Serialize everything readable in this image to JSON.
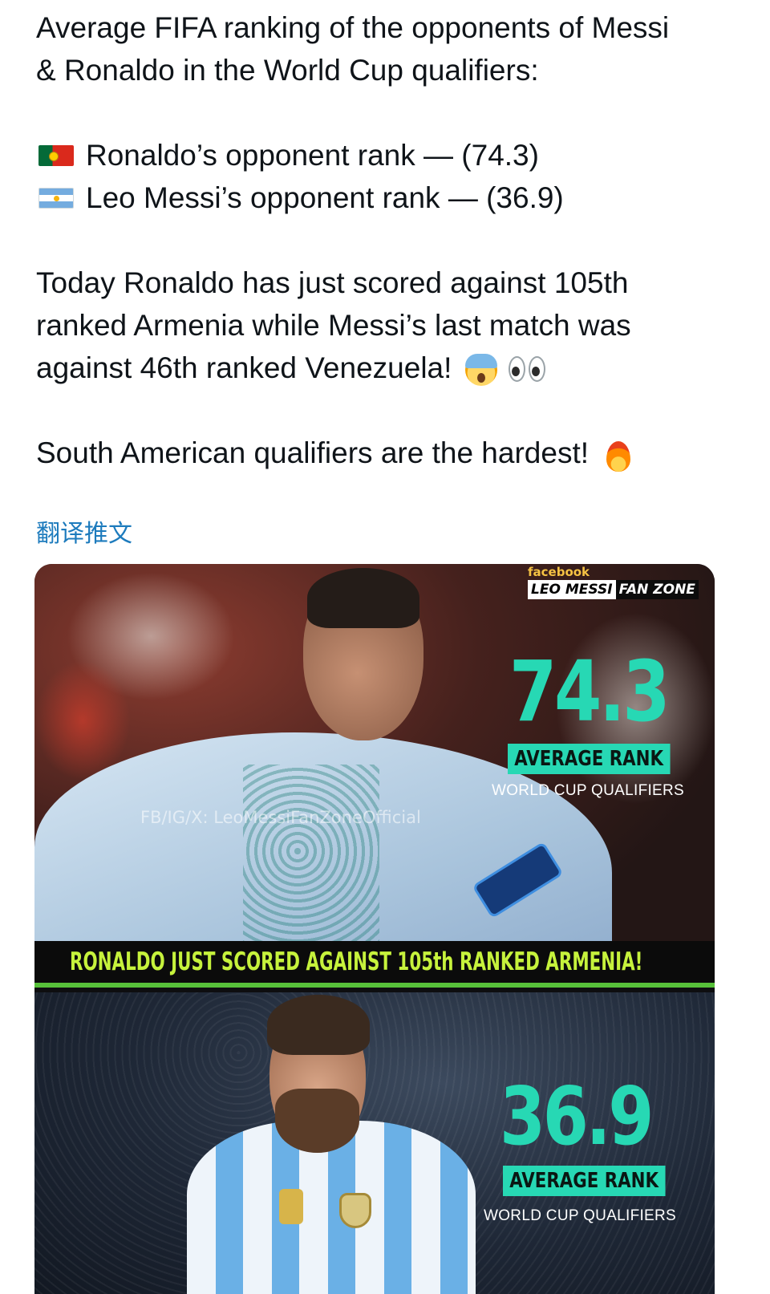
{
  "tweet": {
    "line1": "Average FIFA ranking of the opponents of Messi",
    "line2": "& Ronaldo in the World Cup qualifiers:",
    "ronaldo_line": "Ronaldo’s opponent rank — (74.3)",
    "messi_line": "Leo Messi’s opponent rank — (36.9)",
    "para2_line1": "Today Ronaldo has just scored against 105th",
    "para2_line2": "ranked Armenia while Messi’s last match was",
    "para2_line3": "against 46th ranked Venezuela!",
    "para3": "South American qualifiers are the hardest!",
    "translate_link": "翻译推文"
  },
  "icons": {
    "portugal_flag": "portugal-flag-icon",
    "argentina_flag": "argentina-flag-icon",
    "scream": "face-screaming-icon",
    "eyes": "eyes-icon",
    "fire": "fire-icon"
  },
  "media": {
    "panel1": {
      "facebook": "facebook",
      "fan_zone_a": "LEO MESSI",
      "fan_zone_b": "FAN ZONE",
      "number": "74.3",
      "rank_label": "AVERAGE RANK",
      "subtitle": "WORLD CUP QUALIFIERS",
      "watermark": "FB/IG/X: LeoMessiFanZoneOfficial",
      "banner": "RONALDO JUST SCORED AGAINST 105th RANKED ARMENIA!"
    },
    "panel2": {
      "number": "36.9",
      "rank_label": "AVERAGE RANK",
      "subtitle": "WORLD CUP QUALIFIERS"
    }
  },
  "colors": {
    "accent_teal": "#27d8b4",
    "banner_text": "#c6f23c",
    "link_blue": "#1d7bbd"
  }
}
